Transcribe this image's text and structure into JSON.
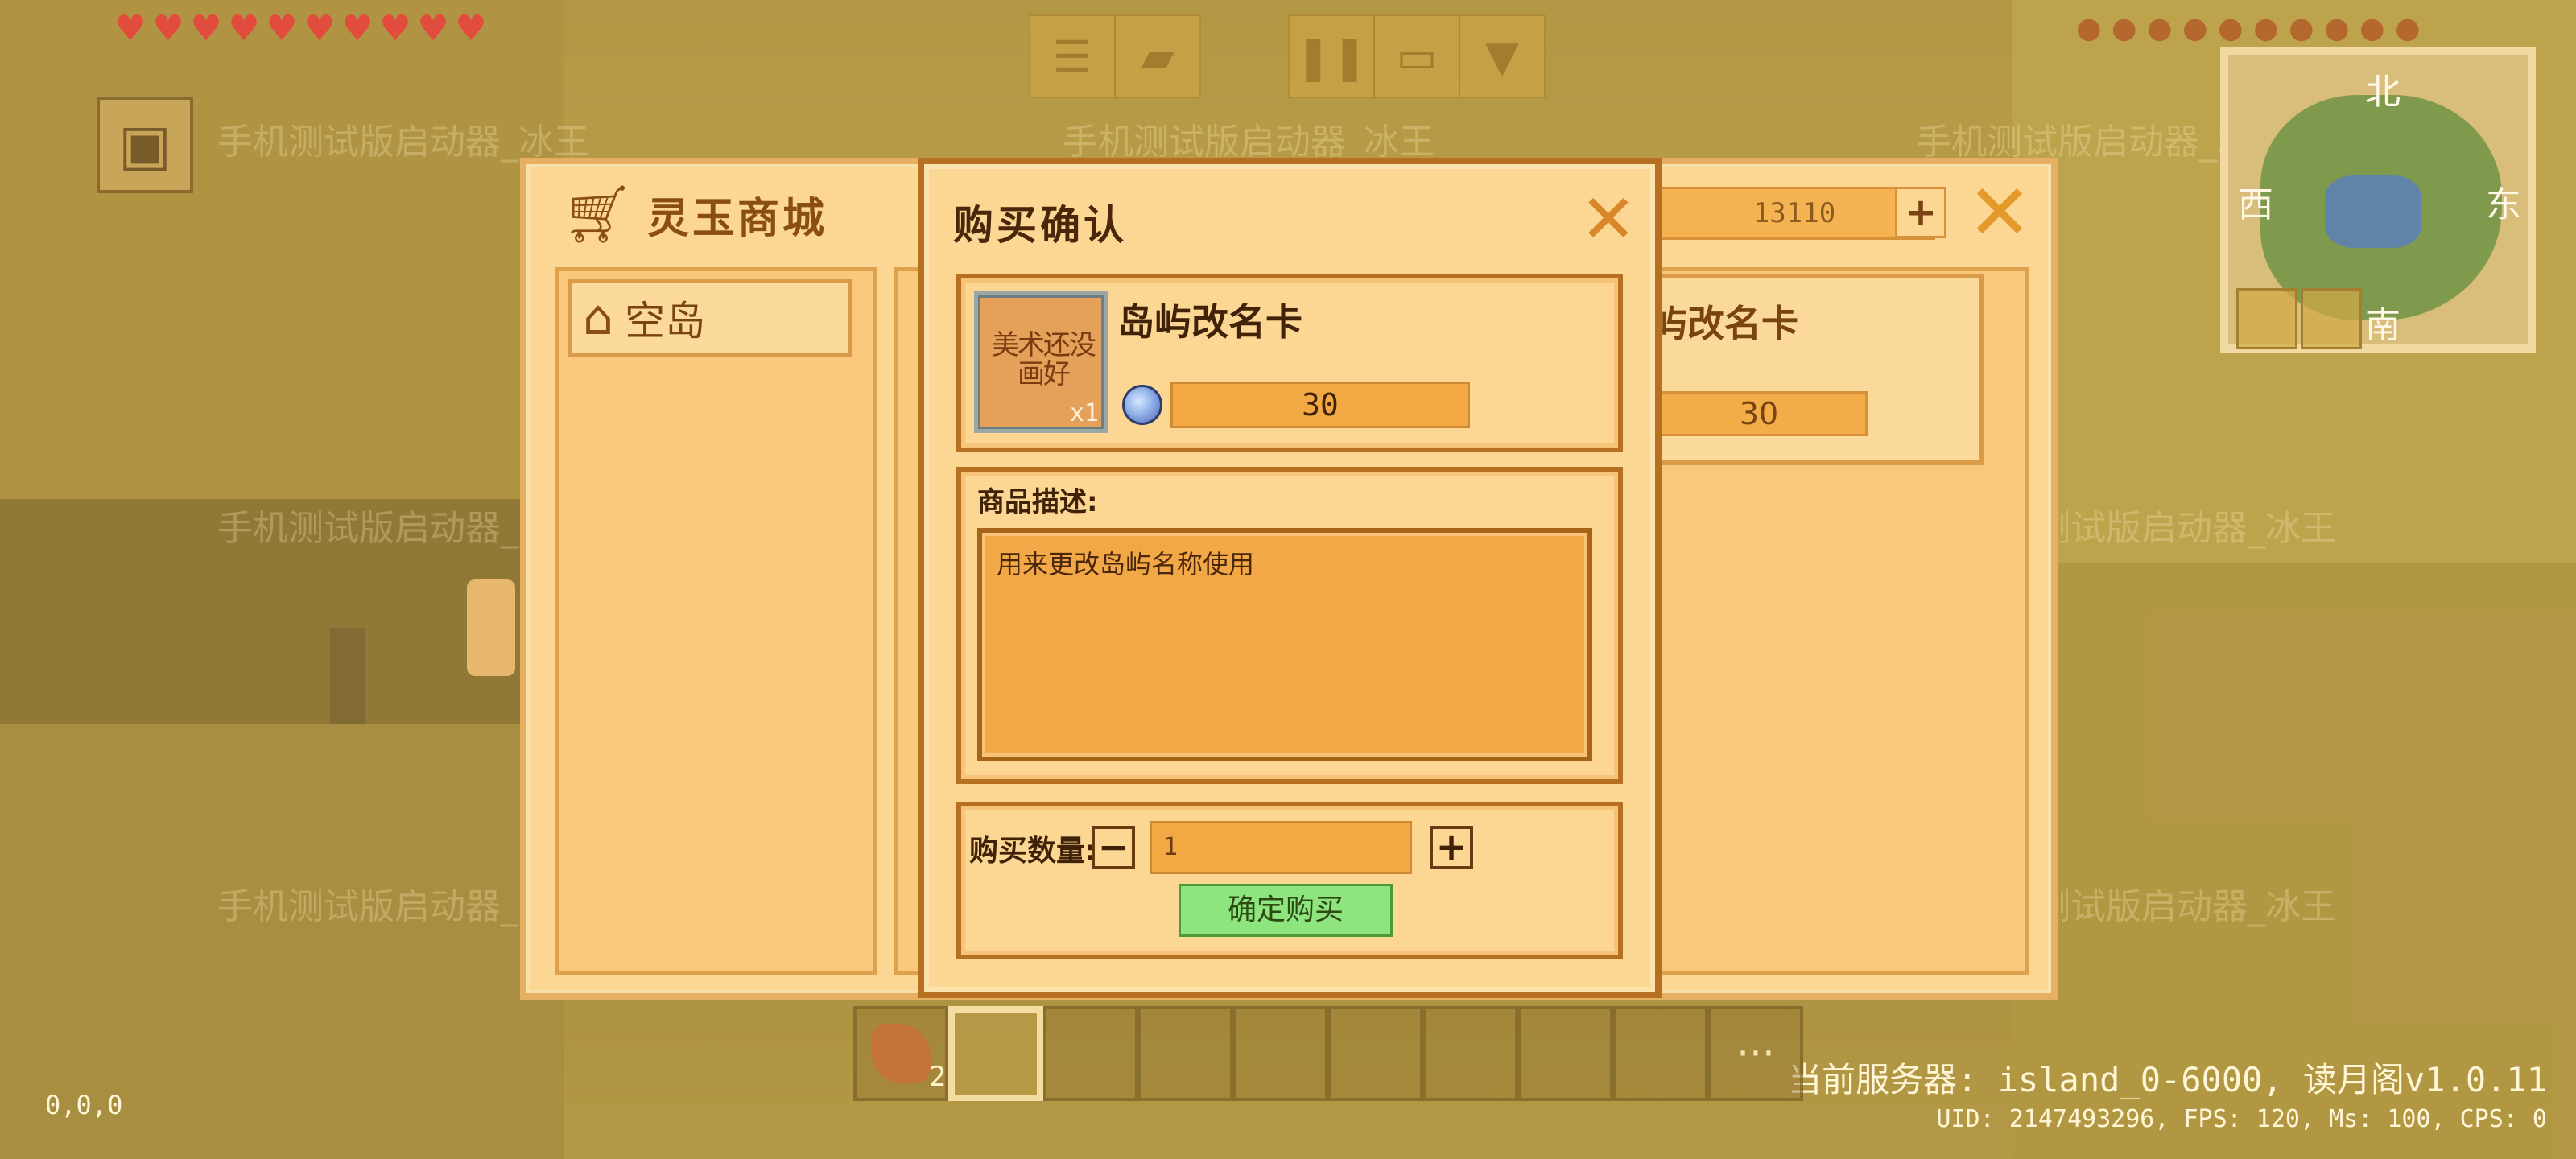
{
  "hud": {
    "hearts": [
      "heart",
      "heart",
      "heart",
      "heart",
      "heart",
      "heart",
      "heart",
      "heart",
      "heart",
      "heart"
    ],
    "hunger": [
      "drumstick",
      "drumstick",
      "drumstick",
      "drumstick",
      "drumstick",
      "drumstick",
      "drumstick",
      "drumstick",
      "drumstick",
      "drumstick"
    ],
    "coords": "0,0,0",
    "server_line1": "当前服务器: island_0-6000, 读月阁v1.0.11",
    "server_line2": "UID: 2147493296, FPS: 120, Ms: 100, CPS: 0",
    "watermark": "手机测试版启动器_冰王"
  },
  "minimap": {
    "north": "北",
    "south": "南",
    "east": "东",
    "west": "西"
  },
  "hotbar": {
    "selected_index": 1,
    "first_item_count": "2",
    "more_label": "···"
  },
  "shop": {
    "title": "灵玉商城",
    "currency_amount": "13110",
    "add_label": "+",
    "close_label": "✕",
    "category": "空岛",
    "card_name": "屿改名卡",
    "card_price": "30"
  },
  "dialog": {
    "title": "购买确认",
    "close_label": "✕",
    "item": {
      "name": "岛屿改名卡",
      "icon_text": "美术还没画好",
      "qty": "x1",
      "price": "30"
    },
    "description_label": "商品描述:",
    "description": "用来更改岛屿名称使用",
    "quantity_label": "购买数量:",
    "minus_label": "−",
    "plus_label": "+",
    "quantity_value": "1",
    "confirm_label": "确定购买"
  }
}
